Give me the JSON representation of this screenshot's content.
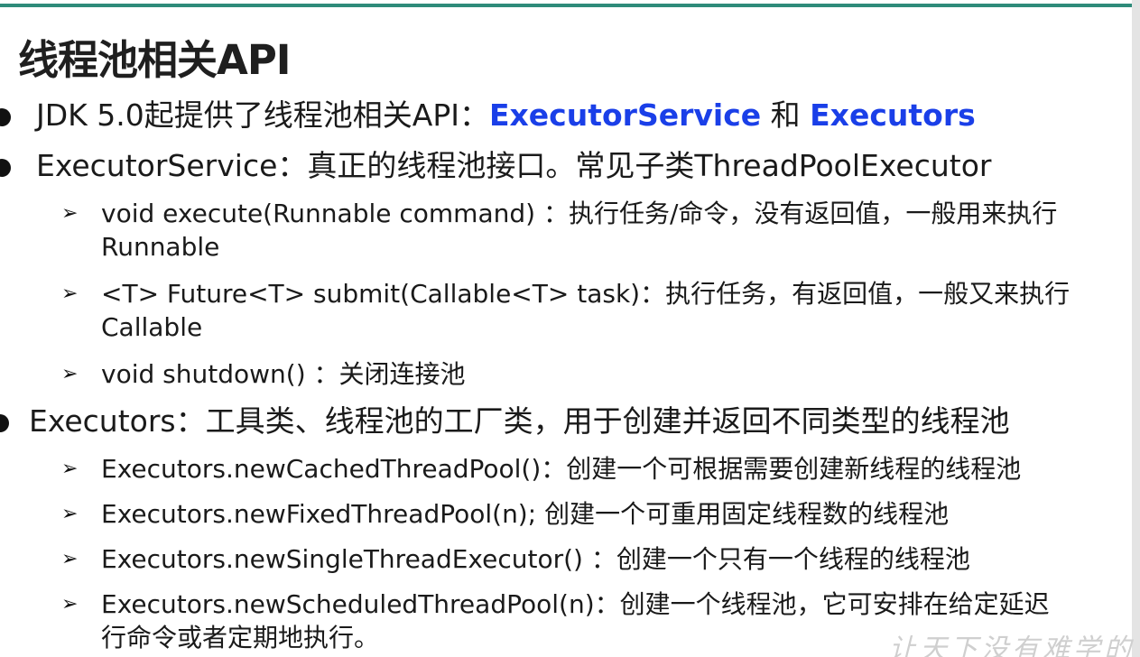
{
  "title": "线程池相关API",
  "bullets": {
    "b1": {
      "prefix": "JDK 5.0起提供了线程池相关API：",
      "hl1": "ExecutorService",
      "mid": " 和 ",
      "hl2": "Executors"
    },
    "b2": {
      "text": "ExecutorService：真正的线程池接口。常见子类ThreadPoolExecutor",
      "subs": [
        {
          "line1": "void execute(Runnable command) ：执行任务/命令，没有返回值，一般用来执行",
          "line2": "Runnable"
        },
        {
          "line1": "<T> Future<T> submit(Callable<T> task)：执行任务，有返回值，一般又来执行",
          "line2": "Callable"
        },
        {
          "line1": "void shutdown() ：关闭连接池"
        }
      ]
    },
    "b3": {
      "text": "Executors：工具类、线程池的工厂类，用于创建并返回不同类型的线程池",
      "subs": [
        {
          "line1": "Executors.newCachedThreadPool()：创建一个可根据需要创建新线程的线程池"
        },
        {
          "line1": "Executors.newFixedThreadPool(n); 创建一个可重用固定线程数的线程池"
        },
        {
          "line1": "Executors.newSingleThreadExecutor() ：创建一个只有一个线程的线程池"
        },
        {
          "line1": "Executors.newScheduledThreadPool(n)：创建一个线程池，它可安排在给定延迟",
          "line2": "行命令或者定期地执行。"
        }
      ]
    }
  },
  "arrow_glyph": "➢",
  "watermark": "让天下没有难学的",
  "colors": {
    "accent_rule": "#2e8b7a",
    "highlight": "#1a3fe8",
    "text": "#1a1a1a"
  }
}
